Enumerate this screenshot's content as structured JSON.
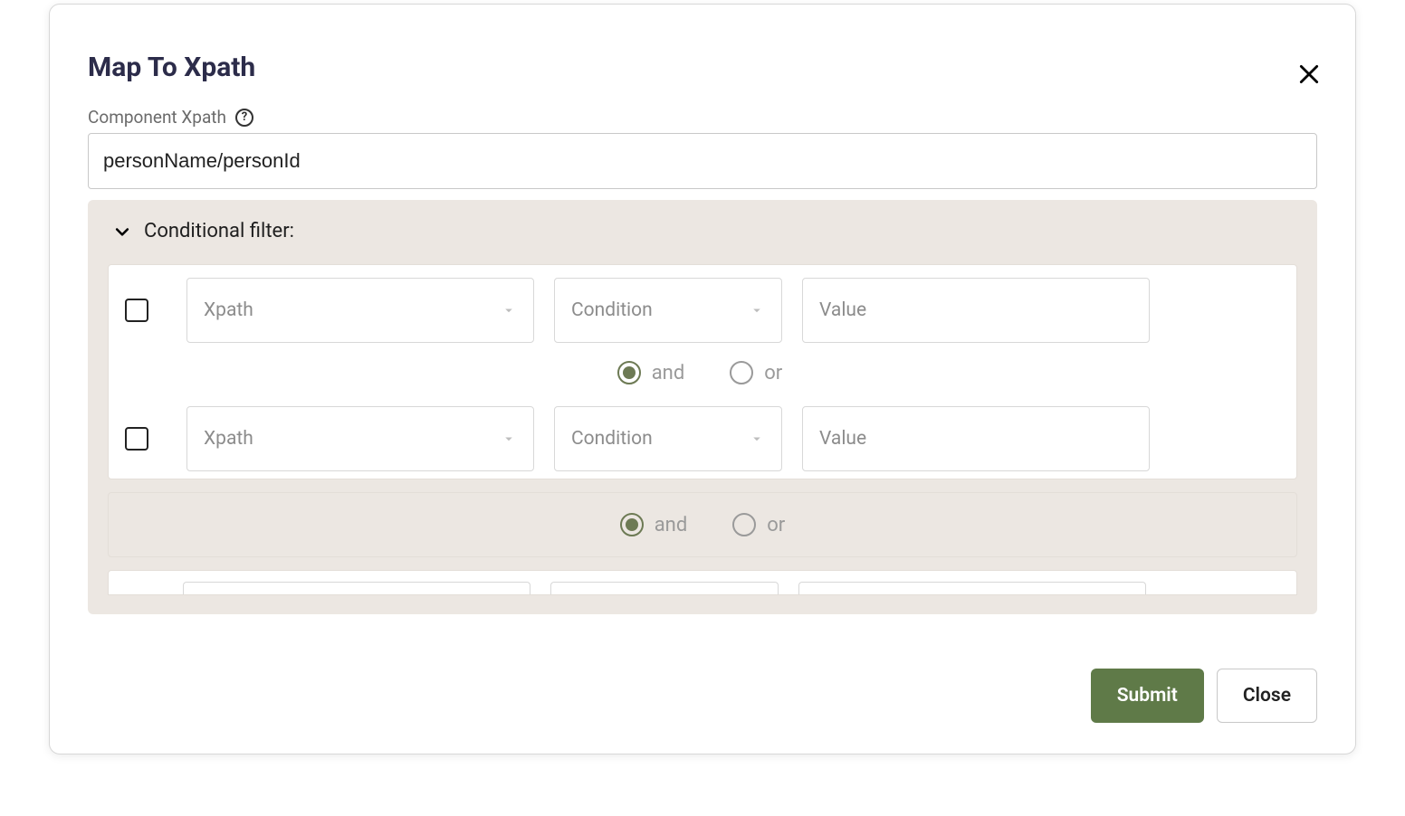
{
  "dialog": {
    "title": "Map To Xpath",
    "field_label": "Component Xpath",
    "xpath_value": "personName/personId",
    "submit_label": "Submit",
    "close_label": "Close"
  },
  "cond": {
    "title": "Conditional filter:",
    "placeholders": {
      "xpath": "Xpath",
      "condition": "Condition",
      "value": "Value"
    },
    "logic": {
      "and": "and",
      "or": "or",
      "selected": "and"
    },
    "rows": [
      {
        "checked": false,
        "xpath": "",
        "condition": "",
        "value": ""
      },
      {
        "checked": false,
        "xpath": "",
        "condition": "",
        "value": ""
      }
    ],
    "group_logic_selected": "and"
  }
}
